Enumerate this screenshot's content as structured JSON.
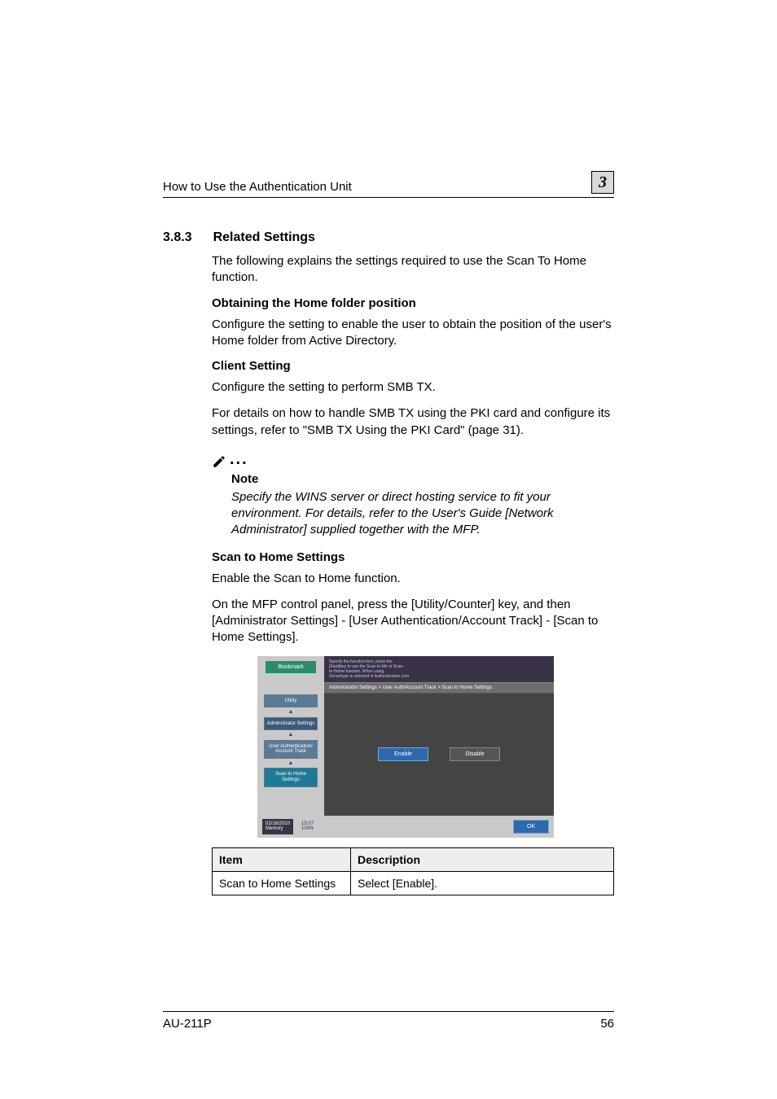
{
  "header": {
    "running_title": "How to Use the Authentication Unit",
    "chapter_number": "3"
  },
  "section": {
    "number": "3.8.3",
    "title": "Related Settings",
    "intro": "The following explains the settings required to use the Scan To Home function."
  },
  "sub1": {
    "heading": "Obtaining the Home folder position",
    "text": "Configure the setting to enable the user to obtain the position of the user's Home folder from Active Directory."
  },
  "sub2": {
    "heading": "Client Setting",
    "text1": "Configure the setting to perform SMB TX.",
    "text2": "For details on how to handle SMB TX using the PKI card and configure its settings, refer to \"SMB TX Using the PKI Card\" (page 31)."
  },
  "note": {
    "label": "Note",
    "text": "Specify the WINS server or direct hosting service to fit your environment. For details, refer to the User's Guide [Network Administrator] supplied together with the MFP."
  },
  "sub3": {
    "heading": "Scan to Home Settings",
    "text1": "Enable the Scan to Home function.",
    "text2": "On the MFP control panel, press the [Utility/Counter] key, and then [Administrator Settings] - [User Authentication/Account Track] - [Scan to Home Settings]."
  },
  "screenshot": {
    "bookmark": "Bookmark",
    "crumbs": [
      "Utility",
      "Administrator Settings",
      "User Authentication/ Account Track",
      "Scan to Home Settings"
    ],
    "banner": "Specify the function item, press the\n[Start]key to use the Scan-to-Me or Scan-\nto-Home function. When using\nServertype is selected in Authentication.com",
    "path": "Administrator Settings > User Auth/Account Track > Scan to Home Settings",
    "enable": "Enable",
    "disable": "Disable",
    "date": "02/16/2010",
    "memory": "Memory",
    "time": "15:07",
    "pct": "100%",
    "ok": "OK"
  },
  "table": {
    "h1": "Item",
    "h2": "Description",
    "r1c1": "Scan to Home Settings",
    "r1c2": "Select [Enable]."
  },
  "footer": {
    "model": "AU-211P",
    "page": "56"
  }
}
